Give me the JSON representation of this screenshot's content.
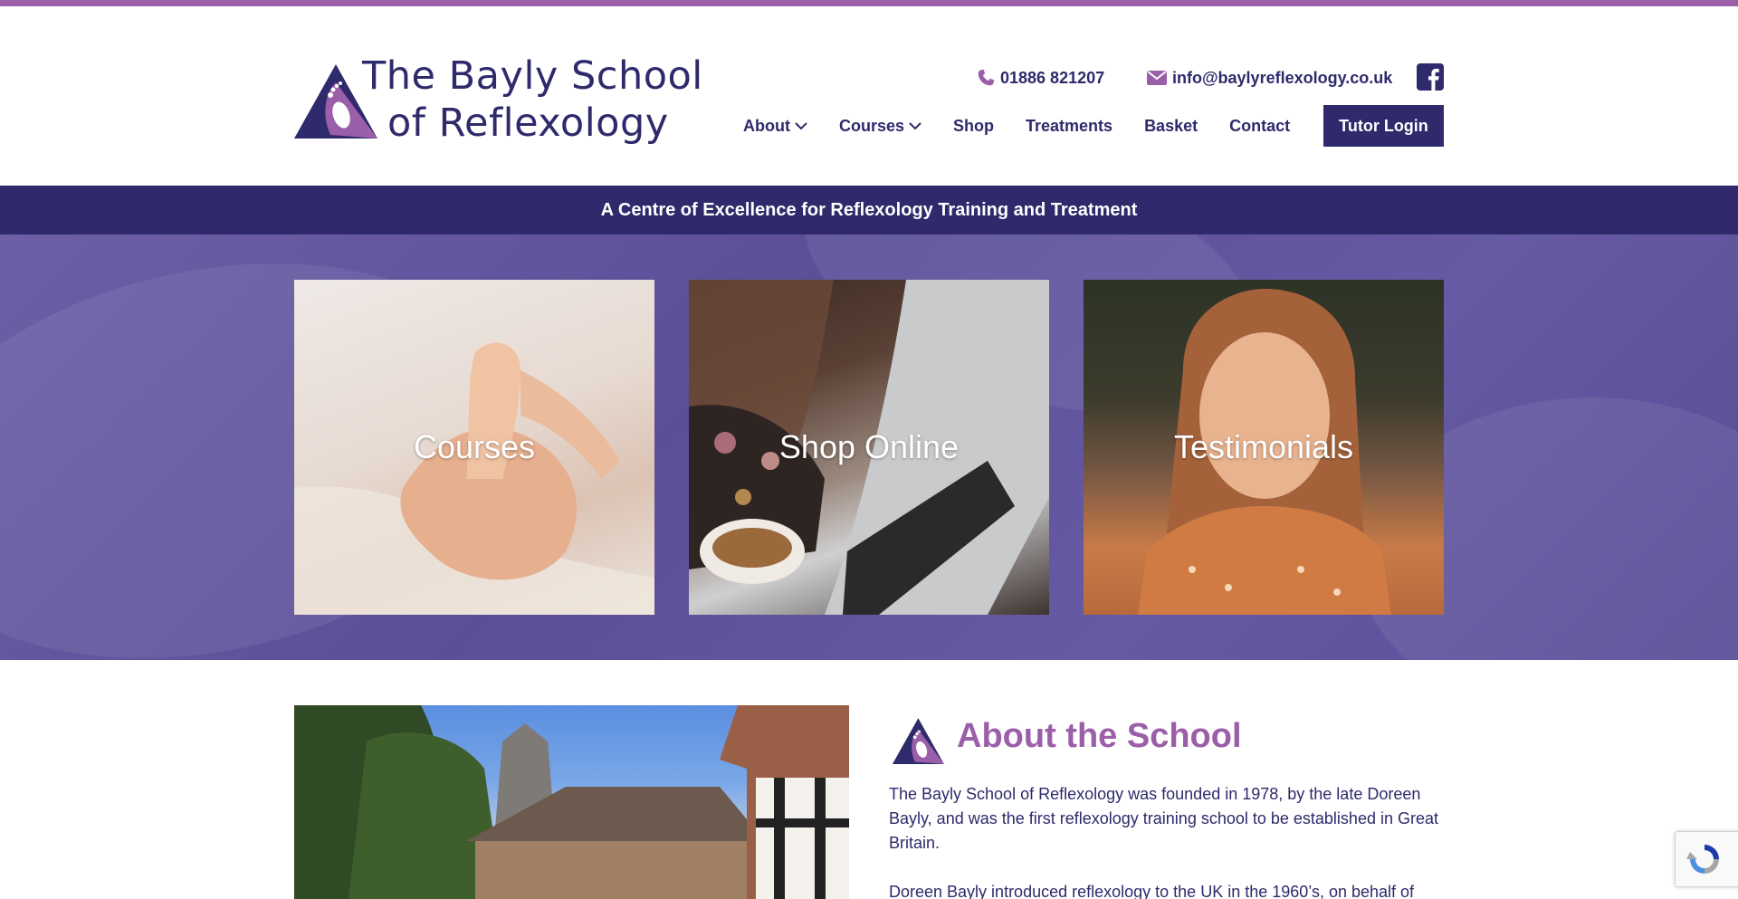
{
  "colors": {
    "brand_navy": "#2e2a6b",
    "brand_purple": "#9b5ea8",
    "hero_purple": "#5e529b"
  },
  "header": {
    "logo": {
      "line1": "The Bayly School",
      "line2": "of Reflexology"
    },
    "phone": {
      "icon": "phone-icon",
      "text": "01886 821207"
    },
    "email": {
      "icon": "envelope-icon",
      "text": "info@baylyreflexology.co.uk"
    },
    "social": {
      "icon": "facebook-icon"
    },
    "nav": {
      "items": [
        {
          "label": "About",
          "has_dropdown": true
        },
        {
          "label": "Courses",
          "has_dropdown": true
        },
        {
          "label": "Shop",
          "has_dropdown": false
        },
        {
          "label": "Treatments",
          "has_dropdown": false
        },
        {
          "label": "Basket",
          "has_dropdown": false
        },
        {
          "label": "Contact",
          "has_dropdown": false
        }
      ],
      "tutor_login": "Tutor Login"
    }
  },
  "tagline": "A Centre of Excellence for Reflexology Training and Treatment",
  "tiles": [
    {
      "label": "Courses",
      "image": "hands-massaging-foot-photo"
    },
    {
      "label": "Shop Online",
      "image": "woman-at-laptop-photo"
    },
    {
      "label": "Testimonials",
      "image": "smiling-woman-photo"
    }
  ],
  "about": {
    "title": "About the School",
    "paragraphs": [
      "The Bayly School of Reflexology was founded in 1978, by the late Doreen Bayly, and was the first reflexology training school to be established in Great Britain.",
      "Doreen Bayly introduced reflexology to the UK in the 1960’s, on behalf of"
    ]
  }
}
